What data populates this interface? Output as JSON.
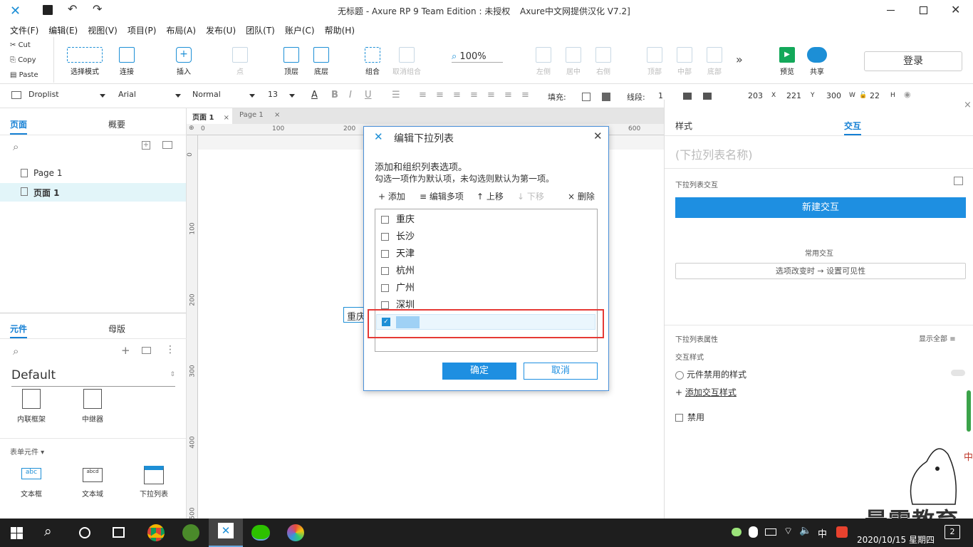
{
  "app": {
    "title": "无标题 - Axure RP 9 Team Edition : 未授权",
    "title_suffix": "Axure中文网提供汉化 V7.2]"
  },
  "menu": [
    "文件(F)",
    "编辑(E)",
    "视图(V)",
    "项目(P)",
    "布局(A)",
    "发布(U)",
    "团队(T)",
    "账户(C)",
    "帮助(H)"
  ],
  "clipboard": {
    "cut": "Cut",
    "copy": "Copy",
    "paste": "Paste"
  },
  "toolbar": {
    "select_mode": "选择模式",
    "connect": "连接",
    "insert": "插入",
    "point": "点",
    "top_layer": "顶层",
    "bottom_layer": "底层",
    "group": "组合",
    "ungroup": "取消组合",
    "zoom": "100%",
    "align_left": "左侧",
    "align_center": "居中",
    "align_right": "右侧",
    "align_top": "顶部",
    "align_middle": "中部",
    "align_bottom": "底部",
    "preview": "预览",
    "share": "共享",
    "login": "登录"
  },
  "format": {
    "widget": "Droplist",
    "font": "Arial",
    "style": "Normal",
    "size": "13",
    "fill_label": "填充:",
    "line_label": "线段:",
    "line_value": "1",
    "x": "203",
    "x_label": "X",
    "y": "221",
    "y_label": "Y",
    "w": "300",
    "w_label": "W",
    "h": "22",
    "h_label": "H"
  },
  "pages": {
    "tab_pages": "页面",
    "tab_outline": "概要",
    "items": [
      "Page 1",
      "页面 1"
    ]
  },
  "library": {
    "tab_widgets": "元件",
    "tab_masters": "母版",
    "library_name": "Default",
    "widgets1": [
      "内联框架",
      "中继器"
    ],
    "section": "表单元件 ▾",
    "widgets2": [
      "文本框",
      "文本域",
      "下拉列表"
    ]
  },
  "canvas": {
    "tabs": [
      "页面 1",
      "Page 1"
    ],
    "ruler_h": [
      "0",
      "100",
      "200",
      "600"
    ],
    "ruler_v": [
      "0",
      "100",
      "200",
      "300",
      "400",
      "500"
    ],
    "widget_text": "重庆"
  },
  "dialog": {
    "title": "编辑下拉列表",
    "desc1": "添加和组织列表选项。",
    "desc2": "勾选一项作为默认项，未勾选则默认为第一项。",
    "add": "+ 添加",
    "edit_multi": "≡ 编辑多项",
    "move_up": "↑ 上移",
    "move_down": "↓ 下移",
    "delete": "× 删除",
    "options": [
      "重庆",
      "长沙",
      "天津",
      "杭州",
      "广州",
      "深圳"
    ],
    "ok": "确定",
    "cancel": "取消"
  },
  "right": {
    "tab_style": "样式",
    "tab_interact": "交互",
    "name_placeholder": "(下拉列表名称)",
    "interactions_label": "下拉列表交互",
    "new_interaction": "新建交互",
    "common": "常用交互",
    "common_item": "选项改变时 → 设置可见性",
    "props": "下拉列表属性",
    "show_all": "显示全部",
    "interact_style": "交互样式",
    "disabled_style": "元件禁用的样式",
    "add_style": "添加交互样式",
    "disable": "禁用"
  },
  "taskbar": {
    "ime": "中",
    "date": "2020/10/15 星期四",
    "notif": "2"
  },
  "watermark": "最需教育",
  "colors": {
    "accent": "#1d8fd6",
    "highlight": "#e53935",
    "selection": "#9fd1f5"
  }
}
